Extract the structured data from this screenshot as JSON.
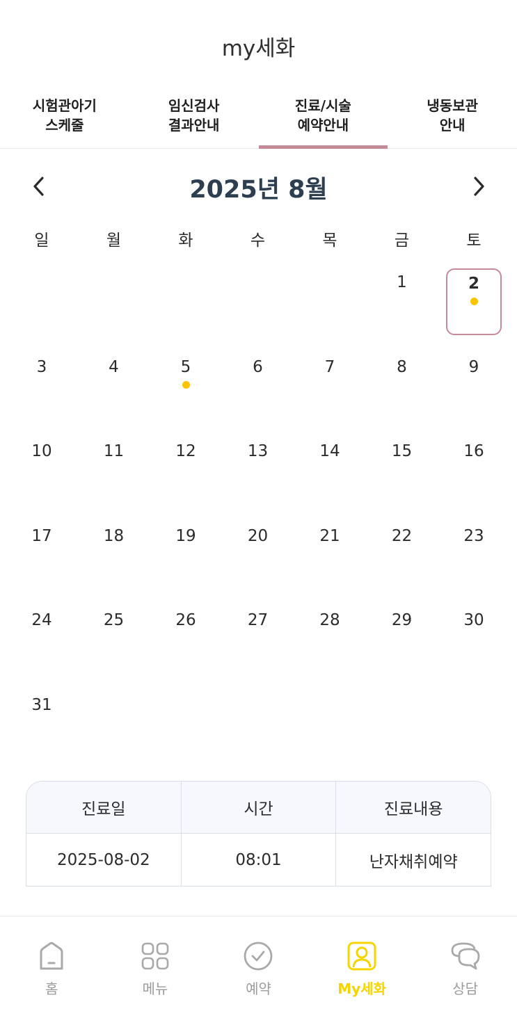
{
  "app": {
    "title": "my세화"
  },
  "tabs": [
    {
      "label": "시험관아기\n스케줄",
      "active": false
    },
    {
      "label": "임신검사\n결과안내",
      "active": false
    },
    {
      "label": "진료/시술\n예약안내",
      "active": true
    },
    {
      "label": "냉동보관\n안내",
      "active": false
    }
  ],
  "calendar": {
    "month_title": "2025년 8월",
    "prev_icon": "chevron-left-icon",
    "next_icon": "chevron-right-icon",
    "weekdays": [
      "일",
      "월",
      "화",
      "수",
      "목",
      "금",
      "토"
    ],
    "first_weekday_index": 5,
    "days_in_month": 31,
    "selected_day": 2,
    "marked_days": [
      2,
      5
    ],
    "dot_color": "#ffc400",
    "selected_border_color": "#c48a97"
  },
  "schedule": {
    "headers": [
      "진료일",
      "시간",
      "진료내용"
    ],
    "rows": [
      [
        "2025-08-02",
        "08:01",
        "난자채취예약"
      ]
    ]
  },
  "bottom_nav": {
    "active_color": "#f5d400",
    "items": [
      {
        "label": "홈",
        "icon": "home-icon",
        "active": false
      },
      {
        "label": "메뉴",
        "icon": "menu-grid-icon",
        "active": false
      },
      {
        "label": "예약",
        "icon": "check-circle-icon",
        "active": false
      },
      {
        "label": "My세화",
        "icon": "user-icon",
        "active": true
      },
      {
        "label": "상담",
        "icon": "chat-icon",
        "active": false
      }
    ]
  }
}
